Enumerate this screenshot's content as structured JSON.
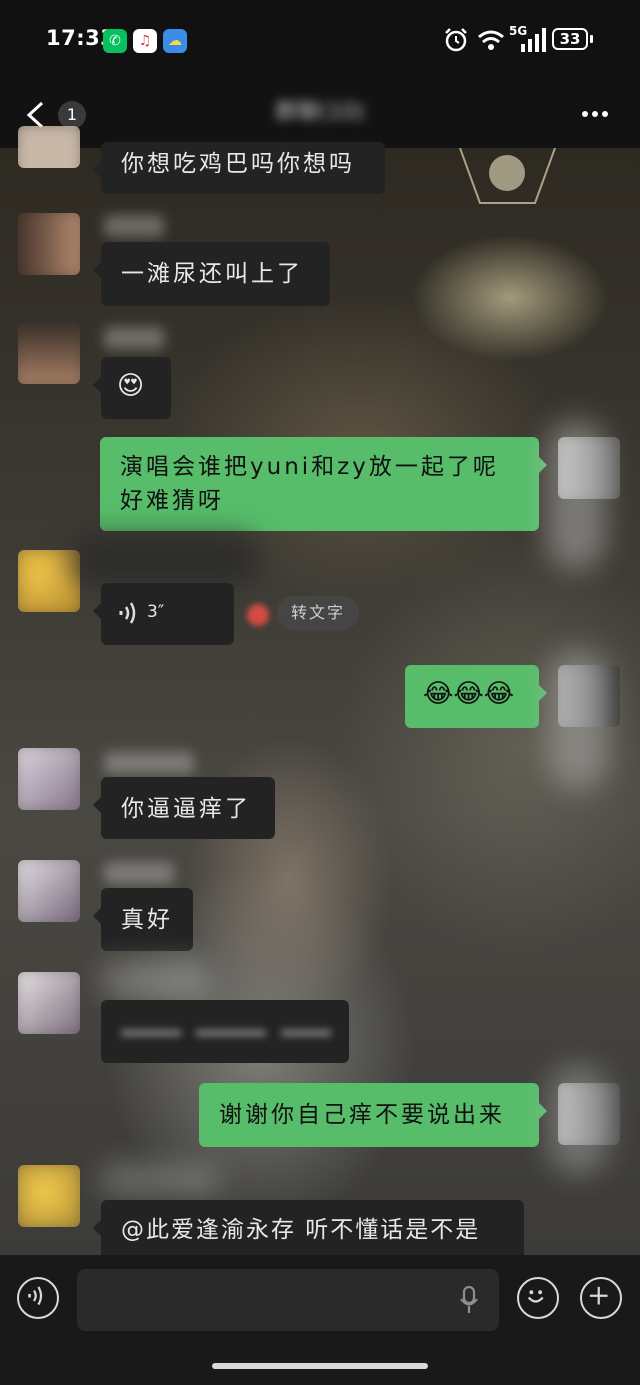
{
  "status_bar": {
    "time": "17:33",
    "network": "5G",
    "battery": "33",
    "app_icons": [
      "wechat-icon",
      "music-icon",
      "weather-icon"
    ]
  },
  "header": {
    "unread_count": "1",
    "title": "群聊(10)",
    "more_icon": "more-dots-icon"
  },
  "messages": [
    {
      "side": "in",
      "text": "你想吃鸡巴吗你想吗"
    },
    {
      "side": "in",
      "text": "一滩尿还叫上了"
    },
    {
      "side": "in",
      "text": "😍"
    },
    {
      "side": "out",
      "text_line1": "演唱会谁把yuni和zy放一起了呢",
      "text_line2": "好难猜呀"
    },
    {
      "side": "in",
      "type": "voice",
      "duration": "3″",
      "transcribe_label": "转文字"
    },
    {
      "side": "out",
      "text": "😂😂😂"
    },
    {
      "side": "in",
      "text": "你逼逼痒了"
    },
    {
      "side": "in",
      "text": "真好"
    },
    {
      "side": "in",
      "type": "redacted"
    },
    {
      "side": "out",
      "text": "谢谢你自己痒不要说出来"
    },
    {
      "side": "in",
      "text": "@此爱逢渝永存  听不懂话是不是"
    }
  ],
  "input_bar": {
    "placeholder": "",
    "icons": [
      "voice-mode-icon",
      "mic-icon",
      "emoji-icon",
      "plus-icon"
    ]
  },
  "colors": {
    "outgoing_bubble": "#57bd6a",
    "incoming_bubble": "#232323",
    "bar_background": "#191919"
  }
}
